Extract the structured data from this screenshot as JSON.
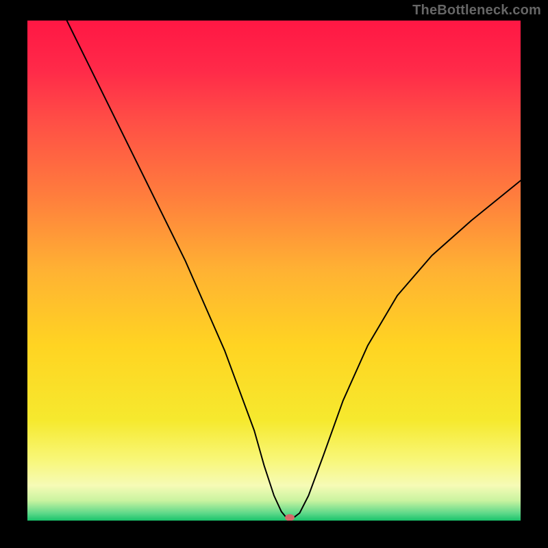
{
  "attribution": "TheBottleneck.com",
  "colors": {
    "gradient_stops": [
      {
        "offset": 0.0,
        "color": "#ff1744"
      },
      {
        "offset": 0.1,
        "color": "#ff2a49"
      },
      {
        "offset": 0.2,
        "color": "#ff4e46"
      },
      {
        "offset": 0.35,
        "color": "#ff7d3d"
      },
      {
        "offset": 0.5,
        "color": "#ffb233"
      },
      {
        "offset": 0.65,
        "color": "#ffd422"
      },
      {
        "offset": 0.8,
        "color": "#f6e92e"
      },
      {
        "offset": 0.88,
        "color": "#f8f77a"
      },
      {
        "offset": 0.93,
        "color": "#f6fbb6"
      },
      {
        "offset": 0.96,
        "color": "#c9f3a0"
      },
      {
        "offset": 0.985,
        "color": "#5fd98a"
      },
      {
        "offset": 1.0,
        "color": "#19c36b"
      }
    ],
    "curve": "#000000",
    "marker": "#d46a6a",
    "page_bg": "#000000"
  },
  "chart_data": {
    "type": "line",
    "title": "",
    "xlabel": "",
    "ylabel": "",
    "xlim": [
      0,
      100
    ],
    "ylim": [
      0,
      100
    ],
    "grid": false,
    "legend": false,
    "series": [
      {
        "name": "bottleneck-curve",
        "x": [
          8,
          12,
          17,
          22,
          27,
          32,
          36,
          40,
          43,
          46,
          48,
          50,
          51.5,
          52.5,
          54,
          55.2,
          57,
          60,
          64,
          69,
          75,
          82,
          90,
          100
        ],
        "y": [
          100,
          92,
          82,
          72,
          62,
          52,
          43,
          34,
          26,
          18,
          11,
          5,
          1.8,
          0.6,
          0.6,
          1.5,
          5,
          13,
          24,
          35,
          45,
          53,
          60,
          68
        ]
      }
    ],
    "annotations": [
      {
        "name": "min-marker",
        "x": 53.2,
        "y": 0.6
      }
    ]
  }
}
